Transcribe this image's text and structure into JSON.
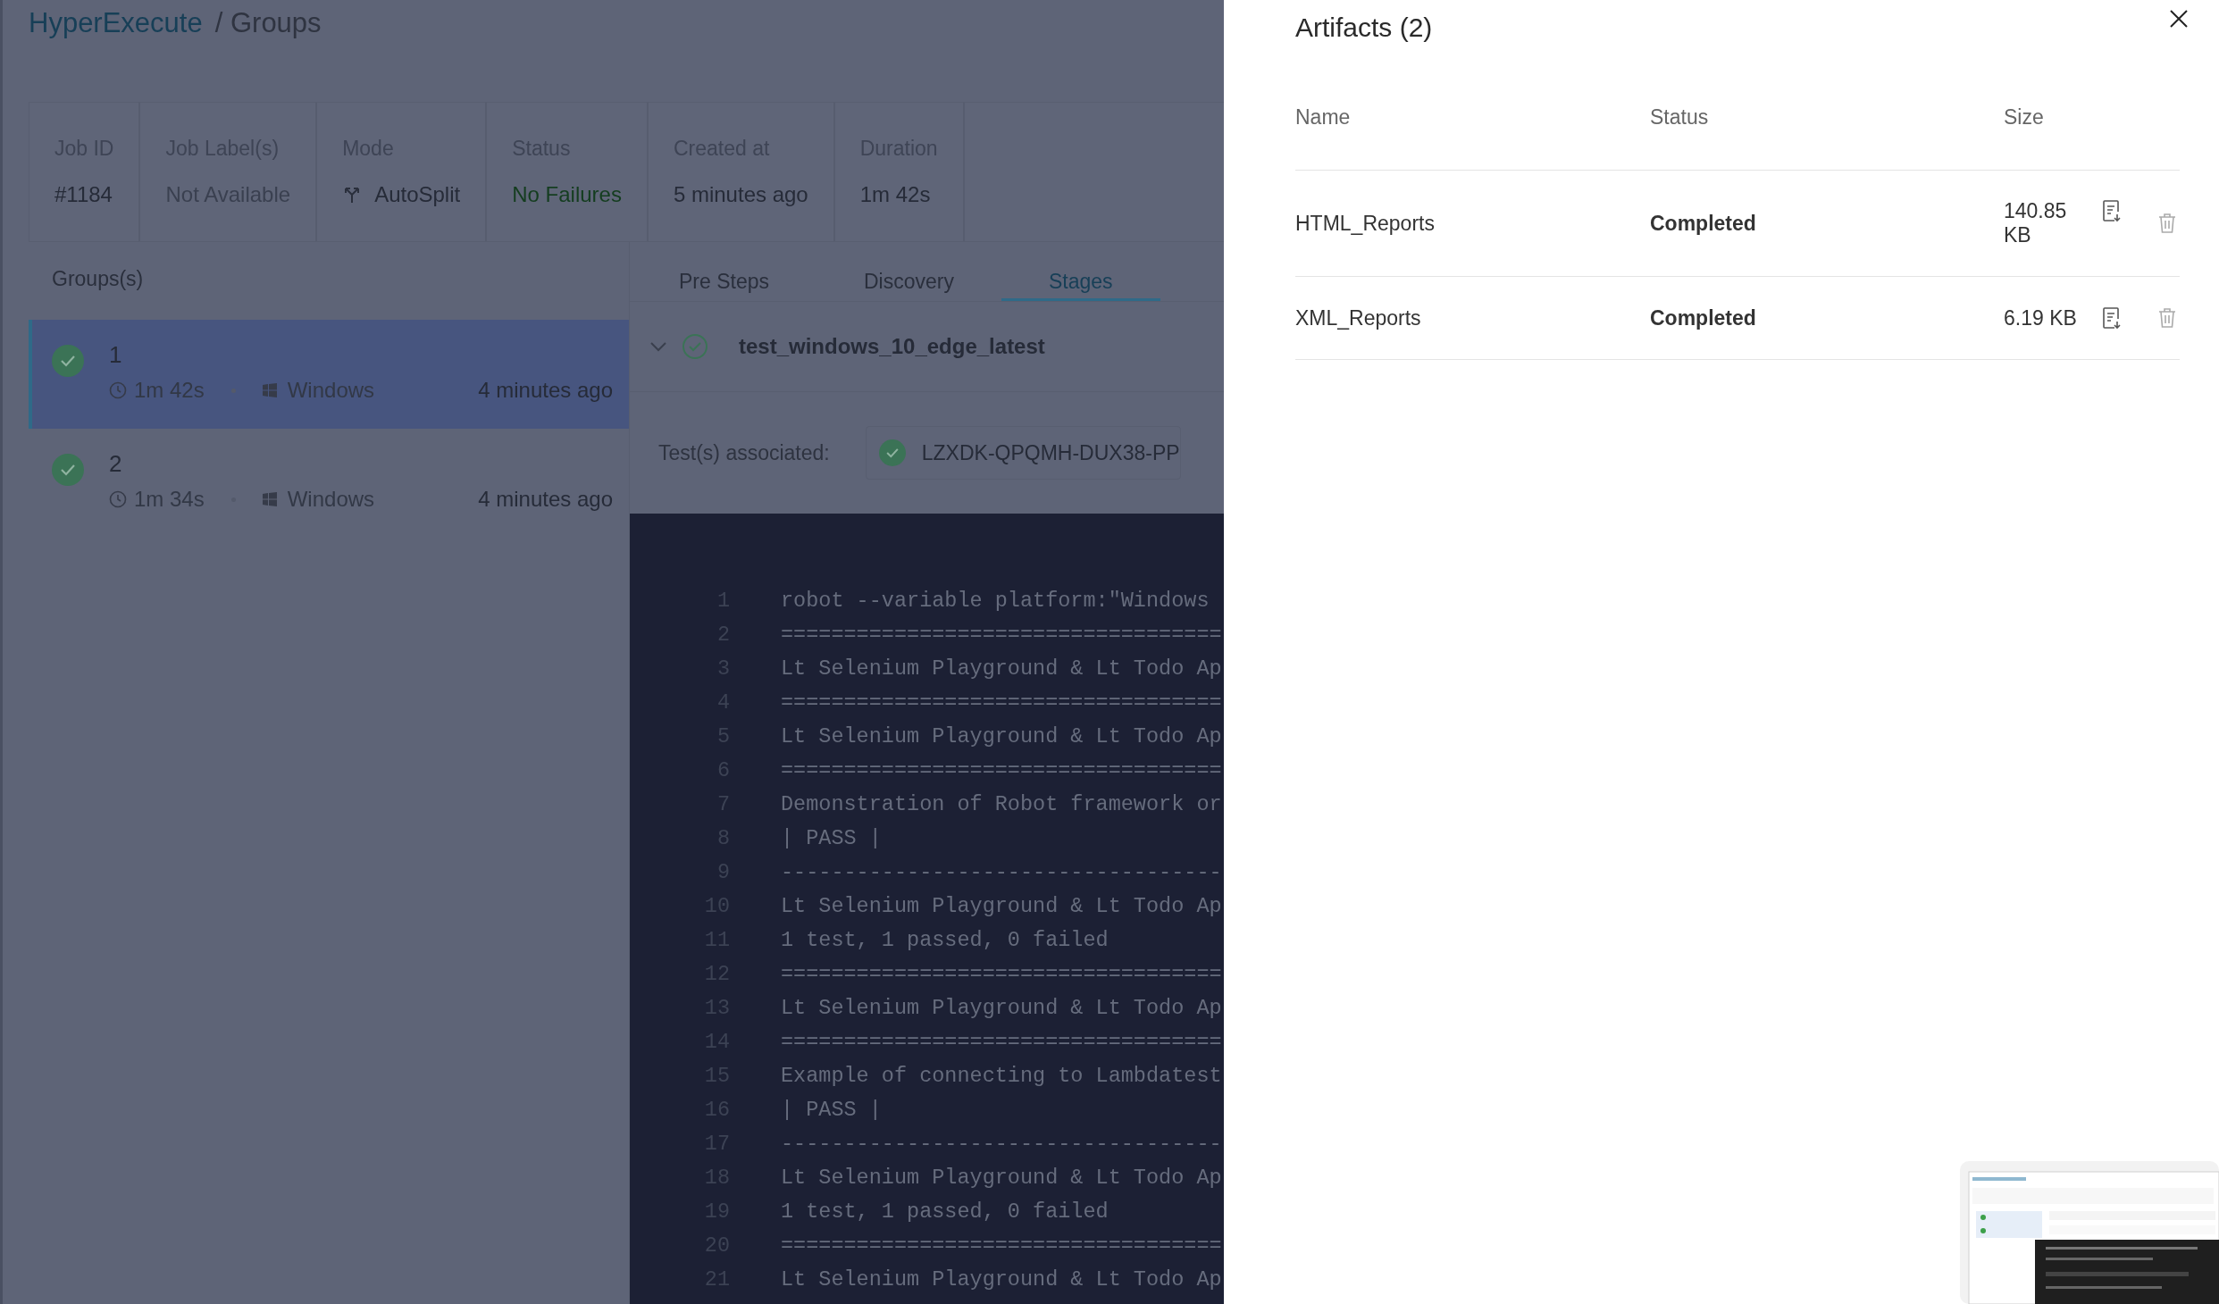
{
  "breadcrumb": {
    "app": "HyperExecute",
    "page": "/ Groups"
  },
  "job_summary": [
    {
      "label": "Job ID",
      "value": "#1184",
      "kind": "plain"
    },
    {
      "label": "Job Label(s)",
      "value": "Not Available",
      "kind": "muted"
    },
    {
      "label": "Mode",
      "value": "AutoSplit",
      "kind": "mode"
    },
    {
      "label": "Status",
      "value": "No Failures",
      "kind": "status"
    },
    {
      "label": "Created at",
      "value": "5 minutes ago",
      "kind": "plain"
    },
    {
      "label": "Duration",
      "value": "1m 42s",
      "kind": "plain"
    }
  ],
  "groups_panel": {
    "title": "Groups(s)",
    "groups": [
      {
        "name": "1",
        "duration": "1m 42s",
        "os": "Windows",
        "time": "4 minutes ago",
        "selected": true,
        "passed": true
      },
      {
        "name": "2",
        "duration": "1m 34s",
        "os": "Windows",
        "time": "4 minutes ago",
        "selected": false,
        "passed": true
      }
    ]
  },
  "tabs": [
    {
      "label": "Pre Steps",
      "selected": false
    },
    {
      "label": "Discovery",
      "selected": false
    },
    {
      "label": "Stages",
      "selected": true
    }
  ],
  "stage": {
    "name": "test_windows_10_edge_latest",
    "expanded": true,
    "passed": true
  },
  "tests_associated": {
    "label": "Test(s) associated:",
    "tests": [
      {
        "id": "LZXDK-QPQMH-DUX38-PP",
        "passed": true
      }
    ]
  },
  "log_lines": [
    {
      "number": "1",
      "text": "robot --variable platform:\"Windows"
    },
    {
      "number": "2",
      "text": "==================================="
    },
    {
      "number": "3",
      "text": "Lt Selenium Playground & Lt Todo Ap"
    },
    {
      "number": "4",
      "text": "==================================="
    },
    {
      "number": "5",
      "text": "Lt Selenium Playground & Lt Todo Ap"
    },
    {
      "number": "6",
      "text": "==================================="
    },
    {
      "number": "7",
      "text": "Demonstration of Robot framework or"
    },
    {
      "number": "8",
      "text": "| PASS |"
    },
    {
      "number": "9",
      "text": "-----------------------------------"
    },
    {
      "number": "10",
      "text": "Lt Selenium Playground & Lt Todo Ap"
    },
    {
      "number": "11",
      "text": "1 test, 1 passed, 0 failed"
    },
    {
      "number": "12",
      "text": "==================================="
    },
    {
      "number": "13",
      "text": "Lt Selenium Playground & Lt Todo Ap"
    },
    {
      "number": "14",
      "text": "==================================="
    },
    {
      "number": "15",
      "text": "Example of connecting to Lambdatest"
    },
    {
      "number": "16",
      "text": "| PASS |"
    },
    {
      "number": "17",
      "text": "-----------------------------------"
    },
    {
      "number": "18",
      "text": "Lt Selenium Playground & Lt Todo Ap"
    },
    {
      "number": "19",
      "text": "1 test, 1 passed, 0 failed"
    },
    {
      "number": "20",
      "text": "==================================="
    },
    {
      "number": "21",
      "text": "Lt Selenium Playground & Lt Todo Ap"
    }
  ],
  "artifacts_drawer": {
    "title": "Artifacts (2)",
    "columns": [
      "Name",
      "Status",
      "Size"
    ],
    "rows": [
      {
        "name": "HTML_Reports",
        "status": "Completed",
        "size": "140.85 KB"
      },
      {
        "name": "XML_Reports",
        "status": "Completed",
        "size": "6.19 KB"
      }
    ]
  }
}
